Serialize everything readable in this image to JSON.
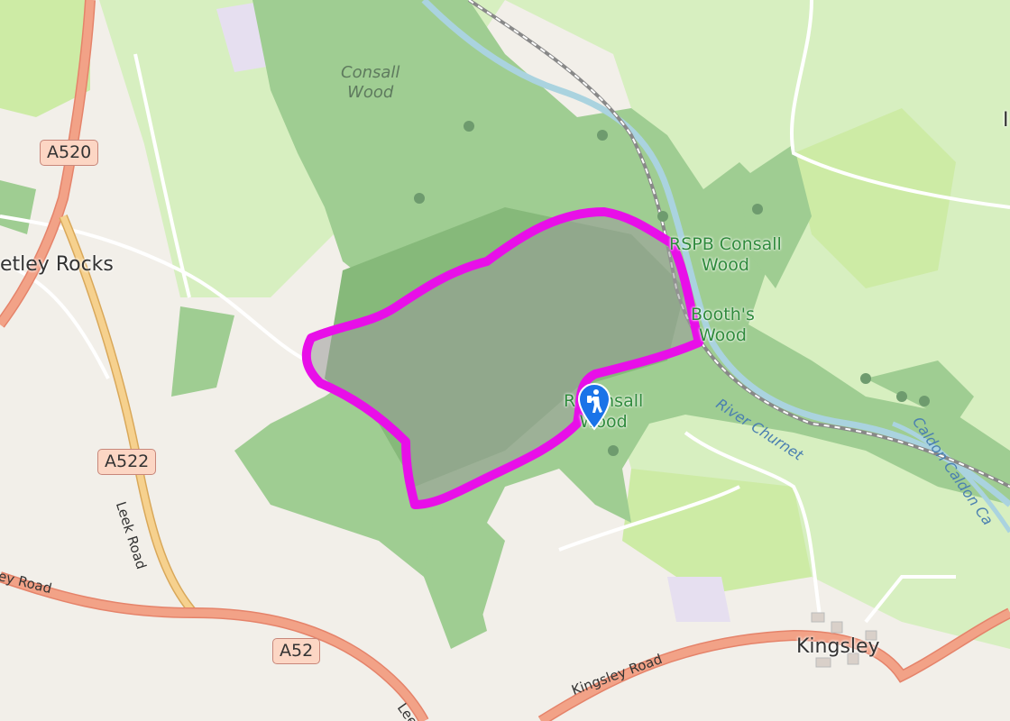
{
  "map": {
    "colors": {
      "background": "#f2efe9",
      "meadow": "#d7efc0",
      "grass": "#cdeba5",
      "wood": "#9fcd92",
      "wood_dark": "#86b97a",
      "water": "#aad3df",
      "primary_road": "#f2a287",
      "primary_casing": "#e5836a",
      "secondary_road": "#f6d18e",
      "minor_road": "#ffffff",
      "railway": "#888888",
      "route": "#e80fe8",
      "area_fill": "#9a9a9a"
    },
    "place_labels": [
      {
        "id": "cheddleton-heath",
        "text": "etley Rocks"
      },
      {
        "id": "kingsley",
        "text": "Kingsley"
      }
    ],
    "wood_labels": [
      {
        "id": "consall-wood",
        "line1": "Consall",
        "line2": "Wood"
      }
    ],
    "reserve_labels": [
      {
        "id": "rspb-consall",
        "line1": "RSPB Consall",
        "line2": "Wood"
      },
      {
        "id": "booths-wood",
        "line1": "Booth's",
        "line2": "Wood"
      },
      {
        "id": "rspb-consall-2",
        "line1": "R  Consall",
        "line2": "Wood"
      }
    ],
    "water_labels": [
      {
        "id": "river-churnet",
        "text": "River Churnet"
      },
      {
        "id": "caldon-canal",
        "text": "Caldon Caldon Ca"
      }
    ],
    "road_shields": [
      {
        "id": "a520",
        "text": "A520"
      },
      {
        "id": "a22",
        "text": "A522"
      },
      {
        "id": "a52",
        "text": "A52"
      }
    ],
    "road_names": [
      {
        "id": "leek-road",
        "text": "Leek Road"
      },
      {
        "id": "ey-road",
        "text": "ey Road"
      },
      {
        "id": "kingsley-road",
        "text": "Kingsley Road"
      },
      {
        "id": "lee-fragment",
        "text": "Lee"
      }
    ],
    "marker": {
      "icon": "hiking-trailhead-icon",
      "color": "#1a73e8"
    },
    "top_right_fragment": "I"
  }
}
